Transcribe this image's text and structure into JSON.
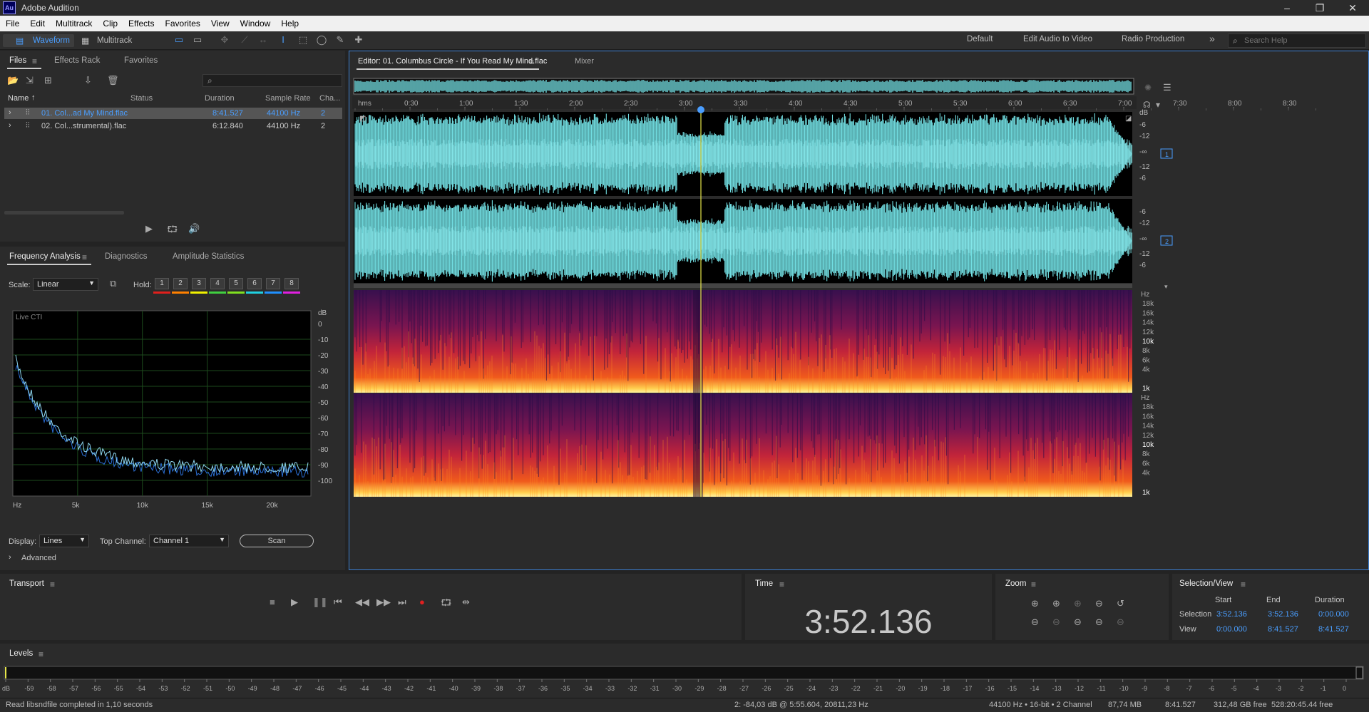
{
  "app": {
    "title": "Adobe Audition",
    "logo": "Au"
  },
  "menu": [
    "File",
    "Edit",
    "Multitrack",
    "Clip",
    "Effects",
    "Favorites",
    "View",
    "Window",
    "Help"
  ],
  "toolbar": {
    "waveform": "Waveform",
    "multitrack": "Multitrack",
    "workspaces": [
      "Default",
      "Edit Audio to Video",
      "Radio Production"
    ],
    "more": "»",
    "search_placeholder": "Search Help"
  },
  "files_panel": {
    "tabs": [
      "Files",
      "Effects Rack",
      "Favorites"
    ],
    "columns": [
      "Name",
      "Status",
      "Duration",
      "Sample Rate",
      "Cha..."
    ],
    "rows": [
      {
        "name": "01. Col...ad My Mind.flac",
        "duration": "8:41.527",
        "rate": "44100 Hz",
        "ch": "2",
        "selected": true
      },
      {
        "name": "02. Col...strumental).flac",
        "duration": "6:12.840",
        "rate": "44100 Hz",
        "ch": "2",
        "selected": false
      }
    ]
  },
  "freq_panel": {
    "tabs": [
      "Frequency Analysis",
      "Diagnostics",
      "Amplitude Statistics"
    ],
    "scale_label": "Scale:",
    "scale_value": "Linear",
    "hold_label": "Hold:",
    "hold": [
      "1",
      "2",
      "3",
      "4",
      "5",
      "6",
      "7",
      "8"
    ],
    "hold_colors": [
      "#e0201c",
      "#ff8000",
      "#f0f000",
      "#40d040",
      "#80e020",
      "#20d0e0",
      "#2090ff",
      "#e020e0"
    ],
    "live": "Live CTI",
    "db_ticks": [
      "dB",
      "0",
      "-10",
      "-20",
      "-30",
      "-40",
      "-50",
      "-60",
      "-70",
      "-80",
      "-90",
      "-100"
    ],
    "hz_ticks": [
      "Hz",
      "5k",
      "10k",
      "15k",
      "20k"
    ],
    "display_label": "Display:",
    "display_value": "Lines",
    "top_channel_label": "Top Channel:",
    "top_channel_value": "Channel 1",
    "scan": "Scan",
    "advanced": "Advanced"
  },
  "editor": {
    "tab": "Editor: 01. Columbus Circle - If You Read My Mind.flac",
    "mixer": "Mixer",
    "timeline": [
      "hms",
      "0:30",
      "1:00",
      "1:30",
      "2:00",
      "2:30",
      "3:00",
      "3:30",
      "4:00",
      "4:30",
      "5:00",
      "5:30",
      "6:00",
      "6:30",
      "7:00",
      "7:30",
      "8:00",
      "8:30"
    ],
    "db_ticks": [
      "dB",
      "-6",
      "-12",
      "-∞",
      "-12",
      "-6"
    ],
    "channel_labels": [
      "1",
      "2"
    ],
    "hz_ticks": [
      "Hz",
      "18k",
      "16k",
      "14k",
      "12k",
      "10k",
      "8k",
      "6k",
      "4k",
      "1k"
    ]
  },
  "transport": {
    "title": "Transport"
  },
  "time": {
    "title": "Time",
    "value": "3:52.136"
  },
  "zoom": {
    "title": "Zoom"
  },
  "selview": {
    "title": "Selection/View",
    "cols": [
      "Start",
      "End",
      "Duration"
    ],
    "rows": [
      {
        "label": "Selection",
        "start": "3:52.136",
        "end": "3:52.136",
        "duration": "0:00.000"
      },
      {
        "label": "View",
        "start": "0:00.000",
        "end": "8:41.527",
        "duration": "8:41.527"
      }
    ]
  },
  "levels": {
    "title": "Levels",
    "ticks": [
      "dB",
      "-59",
      "-58",
      "-57",
      "-56",
      "-55",
      "-54",
      "-53",
      "-52",
      "-51",
      "-50",
      "-49",
      "-48",
      "-47",
      "-46",
      "-45",
      "-44",
      "-43",
      "-42",
      "-41",
      "-40",
      "-39",
      "-38",
      "-37",
      "-36",
      "-35",
      "-34",
      "-33",
      "-32",
      "-31",
      "-30",
      "-29",
      "-28",
      "-27",
      "-26",
      "-25",
      "-24",
      "-23",
      "-22",
      "-21",
      "-20",
      "-19",
      "-18",
      "-17",
      "-16",
      "-15",
      "-14",
      "-13",
      "-12",
      "-11",
      "-10",
      "-9",
      "-8",
      "-7",
      "-6",
      "-5",
      "-4",
      "-3",
      "-2",
      "-1",
      "0"
    ]
  },
  "status": {
    "left": "Read libsndfile completed in 1,10 seconds",
    "cursor": "2: -84,03 dB @ 5:55.604, 20811,23 Hz",
    "format": "44100 Hz • 16-bit • 2 Channel",
    "size": "87,74 MB",
    "duration": "8:41.527",
    "free": "312,48 GB free",
    "free_time": "528:20:45.44 free"
  }
}
